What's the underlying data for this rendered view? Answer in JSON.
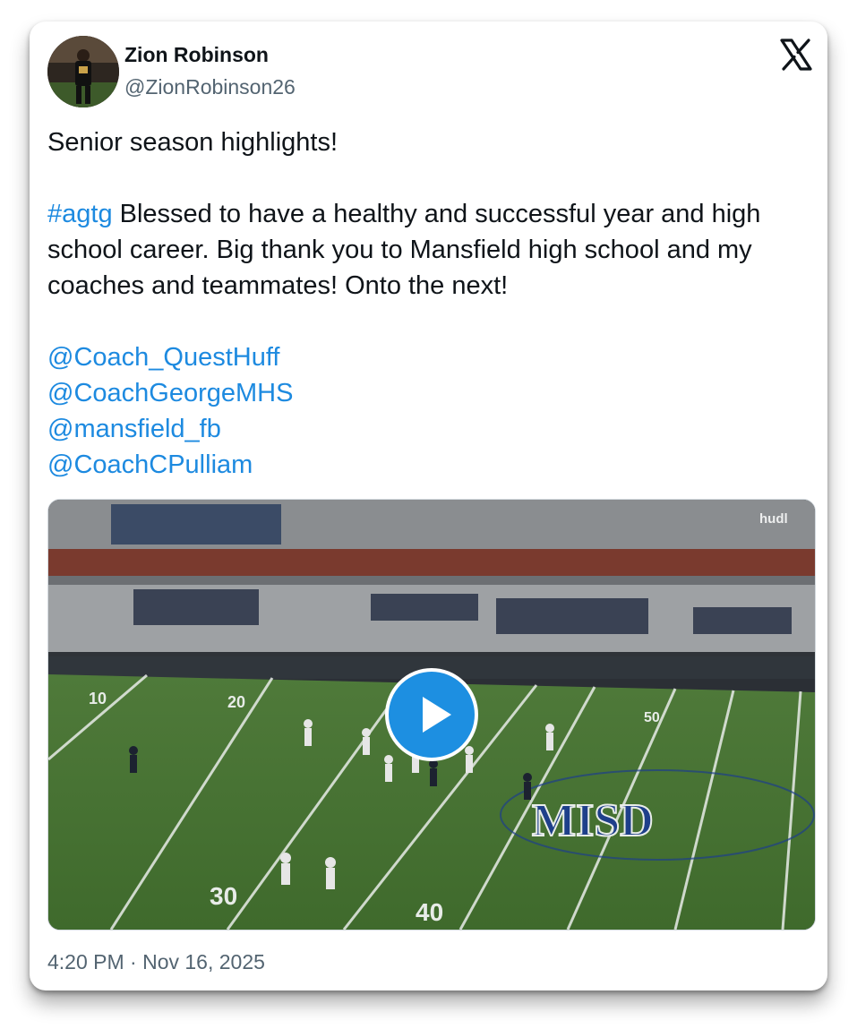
{
  "author": {
    "name": "Zion Robinson",
    "handle": "@ZionRobinson26"
  },
  "brand_icon": "x-logo-icon",
  "tweet": {
    "line1": "Senior season highlights!",
    "hashtag": "#agtg",
    "body": " Blessed to have a healthy and successful year and high school career. Big thank you to Mansfield high school and my coaches and teammates! Onto the next!",
    "mentions": [
      "@Coach_QuestHuff",
      "@CoachGeorgeMHS",
      "@mansfield_fb",
      "@CoachCPulliam"
    ]
  },
  "media": {
    "type": "video",
    "watermark": "hudl",
    "field_logo": "MISD",
    "yard_numbers": [
      "10",
      "20",
      "30",
      "40",
      "50"
    ],
    "play_icon": "play-icon"
  },
  "timestamp": "4:20 PM · Nov 16, 2025",
  "colors": {
    "link": "#1d8ae0",
    "play_button": "#1d8fe1",
    "text": "#0f1419",
    "muted": "#536471"
  }
}
